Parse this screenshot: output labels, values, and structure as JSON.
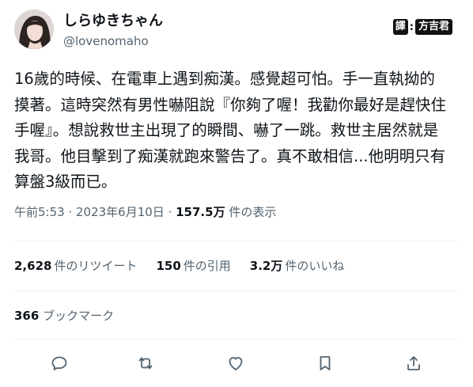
{
  "user": {
    "display_name": "しらゆきちゃん",
    "handle": "@lovenomaho",
    "avatar_icon": "profile-photo"
  },
  "translator": {
    "label": "譯",
    "separator": ":",
    "name": "方吉君"
  },
  "tweet": {
    "text": "16歲的時候、在電車上遇到痴漢。感覺超可怕。手一直執拗的\n摸著。這時突然有男性嚇阻說『你夠了喔！我勸你最好是趕快住\n手喔』。想說救世主出現了的瞬間、嚇了一跳。救世主居然就是\n我哥。他目擊到了痴漢就跑來警告了。真不敢相信...他明明只有\n算盤3級而已。"
  },
  "meta": {
    "time": "午前5:53",
    "separator": " · ",
    "date": "2023年6月10日",
    "views_count": "157.5万",
    "views_label": " 件の表示"
  },
  "stats": {
    "retweets_count": "2,628",
    "retweets_label": "件のリツイート",
    "quotes_count": "150",
    "quotes_label": "件の引用",
    "likes_count": "3.2万",
    "likes_label": "件のいいね"
  },
  "bookmarks": {
    "count": "366",
    "label": "ブックマーク"
  },
  "actions": {
    "icons": [
      "reply-icon",
      "retweet-icon",
      "like-icon",
      "bookmark-icon",
      "share-icon"
    ],
    "icon_color": "#536471"
  }
}
